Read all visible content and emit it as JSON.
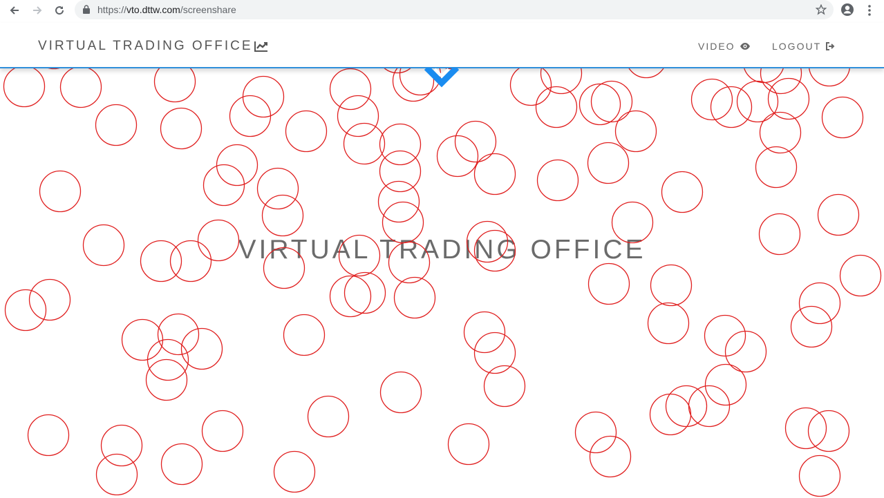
{
  "browser": {
    "url_proto": "https://",
    "url_host": "vto.dttw.com",
    "url_path": "/screenshare"
  },
  "header": {
    "brand": "VIRTUAL TRADING OFFICE",
    "nav": [
      {
        "label": "VIDEO",
        "icon": "eye-icon"
      },
      {
        "label": "LOGOUT",
        "icon": "sign-out-icon"
      }
    ],
    "accent_color": "#2f8fdb"
  },
  "main": {
    "title": "VIRTUAL TRADING OFFICE",
    "circle_color": "#e02020"
  }
}
